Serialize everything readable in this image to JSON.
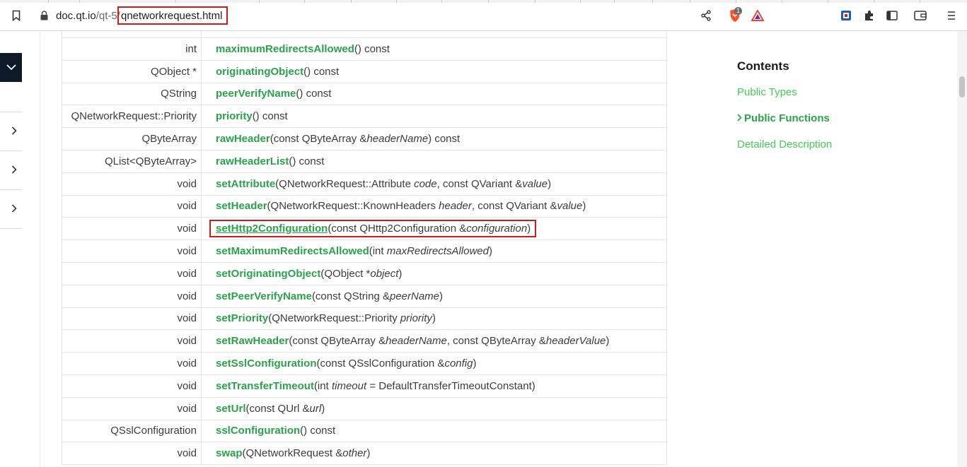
{
  "browser": {
    "url_host": "doc.qt.io",
    "url_path_prefix": "/qt-5/",
    "url_page": "qnetworkrequest.html",
    "brave_badge": "1"
  },
  "table_rows": [
    {
      "type": "int",
      "name": "maximumRedirectsAllowed",
      "sig": [
        {
          "t": "() const"
        }
      ]
    },
    {
      "type": "QObject *",
      "name": "originatingObject",
      "sig": [
        {
          "t": "() const"
        }
      ]
    },
    {
      "type": "QString",
      "name": "peerVerifyName",
      "sig": [
        {
          "t": "() const"
        }
      ]
    },
    {
      "type": "QNetworkRequest::Priority",
      "name": "priority",
      "sig": [
        {
          "t": "() const"
        }
      ]
    },
    {
      "type": "QByteArray",
      "name": "rawHeader",
      "sig": [
        {
          "t": "(const QByteArray &"
        },
        {
          "t": "headerName",
          "i": true
        },
        {
          "t": ") const"
        }
      ]
    },
    {
      "type": "QList<QByteArray>",
      "name": "rawHeaderList",
      "sig": [
        {
          "t": "() const"
        }
      ]
    },
    {
      "type": "void",
      "name": "setAttribute",
      "sig": [
        {
          "t": "(QNetworkRequest::Attribute "
        },
        {
          "t": "code",
          "i": true
        },
        {
          "t": ", const QVariant &"
        },
        {
          "t": "value",
          "i": true
        },
        {
          "t": ")"
        }
      ]
    },
    {
      "type": "void",
      "name": "setHeader",
      "sig": [
        {
          "t": "(QNetworkRequest::KnownHeaders "
        },
        {
          "t": "header",
          "i": true
        },
        {
          "t": ", const QVariant &"
        },
        {
          "t": "value",
          "i": true
        },
        {
          "t": ")"
        }
      ]
    },
    {
      "type": "void",
      "name": "setHttp2Configuration",
      "highlight": true,
      "sig": [
        {
          "t": "(const QHttp2Configuration &"
        },
        {
          "t": "configuration",
          "i": true
        },
        {
          "t": ")"
        }
      ]
    },
    {
      "type": "void",
      "name": "setMaximumRedirectsAllowed",
      "sig": [
        {
          "t": "(int "
        },
        {
          "t": "maxRedirectsAllowed",
          "i": true
        },
        {
          "t": ")"
        }
      ]
    },
    {
      "type": "void",
      "name": "setOriginatingObject",
      "sig": [
        {
          "t": "(QObject *"
        },
        {
          "t": "object",
          "i": true
        },
        {
          "t": ")"
        }
      ]
    },
    {
      "type": "void",
      "name": "setPeerVerifyName",
      "sig": [
        {
          "t": "(const QString &"
        },
        {
          "t": "peerName",
          "i": true
        },
        {
          "t": ")"
        }
      ]
    },
    {
      "type": "void",
      "name": "setPriority",
      "sig": [
        {
          "t": "(QNetworkRequest::Priority "
        },
        {
          "t": "priority",
          "i": true
        },
        {
          "t": ")"
        }
      ]
    },
    {
      "type": "void",
      "name": "setRawHeader",
      "sig": [
        {
          "t": "(const QByteArray &"
        },
        {
          "t": "headerName",
          "i": true
        },
        {
          "t": ", const QByteArray &"
        },
        {
          "t": "headerValue",
          "i": true
        },
        {
          "t": ")"
        }
      ]
    },
    {
      "type": "void",
      "name": "setSslConfiguration",
      "sig": [
        {
          "t": "(const QSslConfiguration &"
        },
        {
          "t": "config",
          "i": true
        },
        {
          "t": ")"
        }
      ]
    },
    {
      "type": "void",
      "name": "setTransferTimeout",
      "sig": [
        {
          "t": "(int "
        },
        {
          "t": "timeout",
          "i": true
        },
        {
          "t": " = DefaultTransferTimeoutConstant)"
        }
      ]
    },
    {
      "type": "void",
      "name": "setUrl",
      "sig": [
        {
          "t": "(const QUrl &"
        },
        {
          "t": "url",
          "i": true
        },
        {
          "t": ")"
        }
      ]
    },
    {
      "type": "QSslConfiguration",
      "name": "sslConfiguration",
      "sig": [
        {
          "t": "() const"
        }
      ]
    },
    {
      "type": "void",
      "name": "swap",
      "sig": [
        {
          "t": "(QNetworkRequest &"
        },
        {
          "t": "other",
          "i": true
        },
        {
          "t": ")"
        }
      ]
    }
  ],
  "contents": {
    "title": "Contents",
    "links": [
      {
        "label": "Public Types",
        "active": false
      },
      {
        "label": "Public Functions",
        "active": true
      },
      {
        "label": "Detailed Description",
        "active": false
      }
    ]
  },
  "colors": {
    "qt_green": "#41cd52",
    "link_green": "#2aa24a",
    "highlight_red": "#d11a1a",
    "sidebar_dark": "#0c1a2a"
  }
}
